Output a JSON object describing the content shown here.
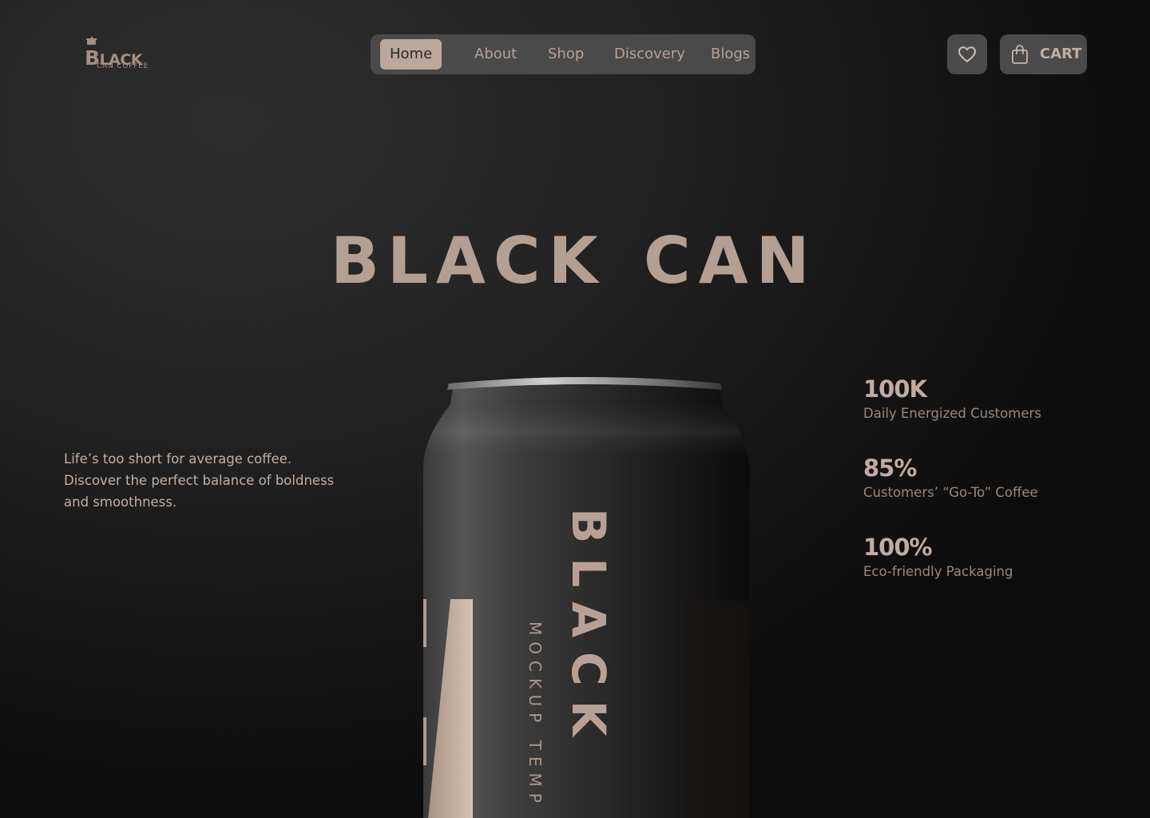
{
  "brand": {
    "logo_initial": "B",
    "logo_rest": "LACK",
    "logo_sub": "CAN COFFEE"
  },
  "nav": {
    "items": [
      {
        "label": "Home",
        "active": true
      },
      {
        "label": "About",
        "active": false
      },
      {
        "label": "Shop",
        "active": false
      },
      {
        "label": "Discovery",
        "active": false
      },
      {
        "label": "Blogs",
        "active": false
      }
    ]
  },
  "actions": {
    "wishlist_icon": "heart-icon",
    "cart_icon": "shopping-bag-icon",
    "cart_label": "CART"
  },
  "hero": {
    "title_word_1": "BLACK",
    "title_word_2": "CAN"
  },
  "tagline": {
    "lines": [
      "Life’s too short for average coffee.",
      "Discover the perfect balance of boldness",
      "and smoothness."
    ]
  },
  "stats": [
    {
      "value": "100K",
      "label": "Daily Energized Customers"
    },
    {
      "value": "85%",
      "label": "Customers’ “Go-To” Coffee"
    },
    {
      "value": "100%",
      "label": "Eco-friendly Packaging"
    }
  ],
  "product": {
    "can_brand": "BLACK",
    "can_sub": "MOCKUP TEMP"
  },
  "colors": {
    "accent": "#b49f93",
    "nav_bg": "#4a4a4a",
    "active_bg": "#bba79b"
  }
}
